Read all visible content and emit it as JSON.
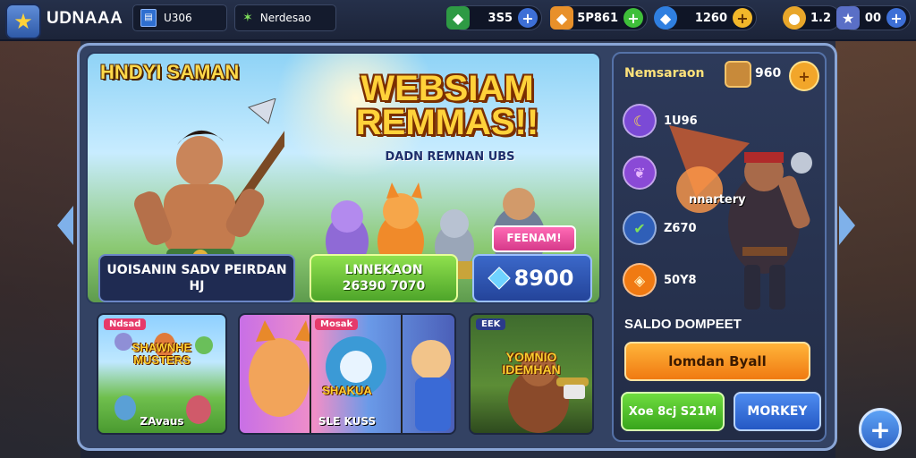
{
  "app": {
    "title": "UDNAAA",
    "icon": "star-icon"
  },
  "topbar": {
    "field_1": {
      "value": "U306",
      "icon": "id-card-icon"
    },
    "field_2": {
      "value": "Nerdesao",
      "icon": "sparkle-icon"
    },
    "resources": [
      {
        "name": "emerald",
        "value": "3S5",
        "icon": "green-gem-icon",
        "color": "#3fbf5a",
        "plus_color": "#3d6fd6"
      },
      {
        "name": "crystal",
        "value": "5P861",
        "icon": "orange-crystal-icon",
        "color": "#f29a2a",
        "plus_color": "#3fbf3a"
      },
      {
        "name": "sapphire",
        "value": "1260",
        "icon": "blue-gem-icon",
        "color": "#3b8ef0",
        "plus_color": "#f2b72a"
      },
      {
        "name": "coin",
        "value": "1.2",
        "icon": "gold-coin-icon",
        "color": "#f2b72a",
        "plus_color": ""
      },
      {
        "name": "star",
        "value": "00",
        "icon": "star-icon",
        "color": "#6a7fd6",
        "plus_color": "#3d6fd6"
      }
    ],
    "plus_label": "+"
  },
  "hero": {
    "tag": "HNDYI SAMAN",
    "title_line1": "WEBSIAM",
    "title_line2": "REMMAS!!",
    "subtitle": "DADN REMNAN UBS",
    "promo_ribbon": "FEENAM!",
    "card_1": {
      "line1": "UOISANIN SADV PEIRDAN",
      "line2": "HJ"
    },
    "card_2": {
      "line1": "LNNEKAON",
      "line2": "26390 7070"
    },
    "card_3": {
      "value": "8900",
      "icon": "blue-gem-icon"
    }
  },
  "tiles": [
    {
      "badge": "Ndsad",
      "title": "SHAWNHE MUSTERS",
      "footer": "ZAvaus"
    },
    {
      "badge": "Mosak",
      "title": "SHAKUA",
      "footer": "SLE KUSS"
    },
    {
      "badge": "EEK",
      "title": "YOMNIO IDEMHAN",
      "footer": ""
    }
  ],
  "side": {
    "title": "Nemsaraon",
    "coin_value": "960",
    "plus_label": "+",
    "stats": [
      {
        "value": "1U96",
        "icon": "banana-icon",
        "color": "#7b4ad6"
      },
      {
        "value": "",
        "icon": "leaf-icon",
        "color": "#8a4ad6"
      },
      {
        "value": "Z670",
        "icon": "checkmark-icon",
        "color": "#2f5fb8"
      },
      {
        "value": "50Y8",
        "icon": "diamond-icon",
        "color": "#f07a12"
      }
    ],
    "villain_label": "nnartery",
    "saldo": "SALDO DOMPEET",
    "btn_orange": "lomdan Byall",
    "btn_green": "Xoe 8cj S21M",
    "btn_blue": "MORKEY"
  },
  "fab": "+"
}
